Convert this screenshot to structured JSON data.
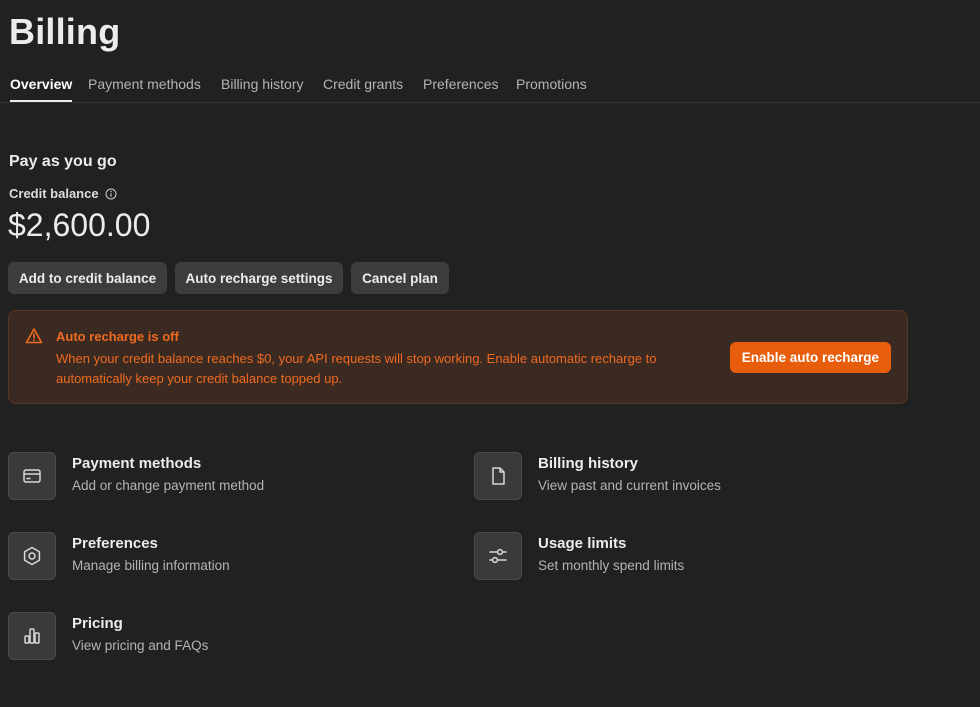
{
  "header": {
    "title": "Billing"
  },
  "tabs": [
    {
      "label": "Overview",
      "active": true
    },
    {
      "label": "Payment methods"
    },
    {
      "label": "Billing history"
    },
    {
      "label": "Credit grants"
    },
    {
      "label": "Preferences"
    },
    {
      "label": "Promotions"
    }
  ],
  "plan": {
    "title": "Pay as you go",
    "credit_label": "Credit balance",
    "balance": "$2,600.00"
  },
  "actions": {
    "add_credit": "Add to credit balance",
    "auto_recharge_settings": "Auto recharge settings",
    "cancel_plan": "Cancel plan"
  },
  "alert": {
    "title": "Auto recharge is off",
    "body": "When your credit balance reaches $0, your API requests will stop working. Enable automatic recharge to automatically keep your credit balance topped up.",
    "button": "Enable auto recharge",
    "color": "#ef6a1f",
    "button_color": "#e85d0c"
  },
  "cards": [
    {
      "title": "Payment methods",
      "subtitle": "Add or change payment method",
      "icon": "credit-card-icon"
    },
    {
      "title": "Billing history",
      "subtitle": "View past and current invoices",
      "icon": "document-icon"
    },
    {
      "title": "Preferences",
      "subtitle": "Manage billing information",
      "icon": "gear-icon"
    },
    {
      "title": "Usage limits",
      "subtitle": "Set monthly spend limits",
      "icon": "sliders-icon"
    },
    {
      "title": "Pricing",
      "subtitle": "View pricing and FAQs",
      "icon": "bar-chart-icon"
    }
  ]
}
